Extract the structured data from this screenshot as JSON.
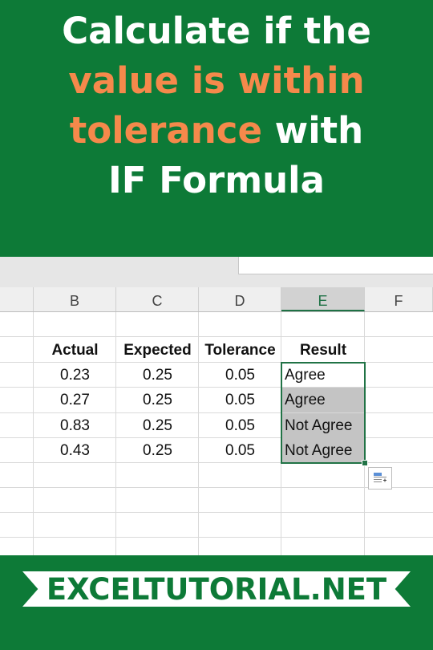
{
  "title": {
    "line1": "Calculate if the",
    "line2": "value is within",
    "line3_highlight": "tolerance",
    "line3_rest": " with",
    "line4": "IF Formula"
  },
  "colors": {
    "banner_green": "#0d7a37",
    "highlight_orange": "#f5894b",
    "selection_green": "#217346",
    "shaded_cell": "#c4c4c4"
  },
  "sheet": {
    "columns": [
      "B",
      "C",
      "D",
      "E",
      "F"
    ],
    "selected_column": "E",
    "headers": {
      "actual": "Actual",
      "expected": "Expected",
      "tolerance": "Tolerance",
      "result": "Result"
    },
    "rows": [
      {
        "actual": "0.23",
        "expected": "0.25",
        "tolerance": "0.05",
        "result": "Agree"
      },
      {
        "actual": "0.27",
        "expected": "0.25",
        "tolerance": "0.05",
        "result": "Agree"
      },
      {
        "actual": "0.83",
        "expected": "0.25",
        "tolerance": "0.05",
        "result": "Not Agree"
      },
      {
        "actual": "0.43",
        "expected": "0.25",
        "tolerance": "0.05",
        "result": "Not Agree"
      }
    ],
    "quick_analysis_icon": "quick-analysis-icon"
  },
  "footer": {
    "site": "EXCELTUTORIAL.NET"
  }
}
